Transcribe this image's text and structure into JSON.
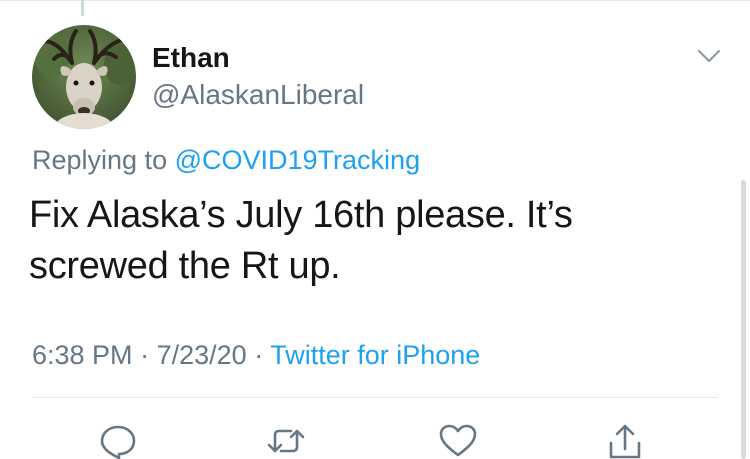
{
  "user": {
    "display_name": "Ethan",
    "handle": "@AlaskanLiberal"
  },
  "reply_context": {
    "prefix": "Replying to",
    "mention": "@COVID19Tracking"
  },
  "tweet": {
    "lines": [
      "Fix Alaska’s July 16th please. It’s",
      "screwed the Rt up."
    ]
  },
  "meta": {
    "time": "6:38 PM",
    "separator": "·",
    "date": "7/23/20",
    "source": "Twitter for iPhone"
  },
  "icons": {
    "avatar": "caribou-avatar",
    "more": "chevron-down-icon",
    "reply": "comment-icon",
    "retweet": "retweet-icon",
    "like": "heart-icon",
    "share": "share-icon"
  },
  "colors": {
    "link": "#1da1f2",
    "secondary_text": "#657786",
    "primary_text": "#14171a",
    "divider": "#e1e8ed"
  }
}
